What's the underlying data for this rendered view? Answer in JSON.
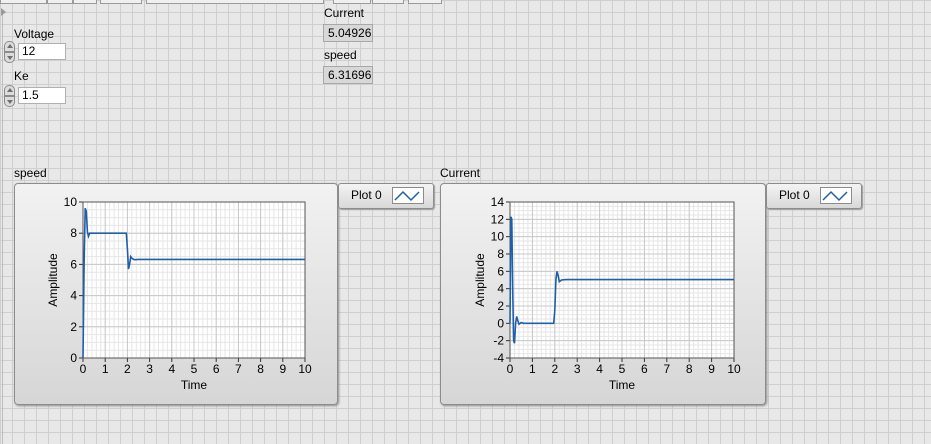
{
  "controls": {
    "voltage": {
      "label": "Voltage",
      "value": "12"
    },
    "ke": {
      "label": "Ke",
      "value": "1.5"
    }
  },
  "indicators": {
    "current": {
      "label": "Current",
      "value": "5.04926"
    },
    "speed": {
      "label": "speed",
      "value": "6.31696"
    }
  },
  "graphs": {
    "speed": {
      "caption": "speed",
      "legend": "Plot 0"
    },
    "current": {
      "caption": "Current",
      "legend": "Plot 0"
    }
  },
  "colors": {
    "trace": "#1f5fa8",
    "grid_major": "#c8c8c8",
    "grid_minor": "#e6e6e6",
    "plot_bg": "#ffffff"
  },
  "chart_data": [
    {
      "type": "line",
      "title": "speed",
      "xlabel": "Time",
      "ylabel": "Amplitude",
      "xlim": [
        0,
        10
      ],
      "ylim": [
        0,
        10
      ],
      "xticks": [
        "0",
        "1",
        "2",
        "3",
        "4",
        "5",
        "6",
        "7",
        "8",
        "9",
        "10"
      ],
      "yticks": [
        "0",
        "2",
        "4",
        "6",
        "8",
        "10"
      ],
      "grid": true,
      "series": [
        {
          "name": "Plot 0",
          "x": [
            0,
            0.05,
            0.1,
            0.15,
            0.2,
            0.25,
            0.3,
            0.35,
            0.4,
            0.5,
            1.0,
            1.5,
            1.95,
            2.0,
            2.05,
            2.1,
            2.15,
            2.2,
            2.3,
            2.5,
            3,
            4,
            5,
            6,
            7,
            8,
            9,
            10
          ],
          "y": [
            0,
            6.0,
            9.6,
            9.4,
            8.1,
            7.8,
            8.0,
            8.0,
            8.0,
            8.0,
            8.0,
            8.0,
            8.0,
            7.0,
            5.7,
            6.0,
            6.5,
            6.4,
            6.3,
            6.32,
            6.32,
            6.32,
            6.32,
            6.32,
            6.32,
            6.32,
            6.32,
            6.32
          ]
        }
      ]
    },
    {
      "type": "line",
      "title": "Current",
      "xlabel": "Time",
      "ylabel": "Amplitude",
      "xlim": [
        0,
        10
      ],
      "ylim": [
        -4,
        14
      ],
      "xticks": [
        "0",
        "1",
        "2",
        "3",
        "4",
        "5",
        "6",
        "7",
        "8",
        "9",
        "10"
      ],
      "yticks": [
        "-4",
        "-2",
        "0",
        "2",
        "4",
        "6",
        "8",
        "10",
        "12",
        "14"
      ],
      "grid": true,
      "series": [
        {
          "name": "Plot 0",
          "x": [
            0,
            0.04,
            0.08,
            0.12,
            0.16,
            0.2,
            0.25,
            0.3,
            0.35,
            0.4,
            0.5,
            0.6,
            1.0,
            1.5,
            1.95,
            2.0,
            2.05,
            2.1,
            2.15,
            2.2,
            2.3,
            2.5,
            3,
            4,
            5,
            6,
            7,
            8,
            9,
            10
          ],
          "y": [
            0,
            12.3,
            12.0,
            4.0,
            -2.0,
            -2.3,
            0.0,
            0.8,
            0.3,
            -0.1,
            0.1,
            0.0,
            0.0,
            0.0,
            0.0,
            1.5,
            5.0,
            6.0,
            5.5,
            4.8,
            5.0,
            5.05,
            5.05,
            5.05,
            5.05,
            5.05,
            5.05,
            5.05,
            5.05,
            5.05
          ]
        }
      ]
    }
  ]
}
